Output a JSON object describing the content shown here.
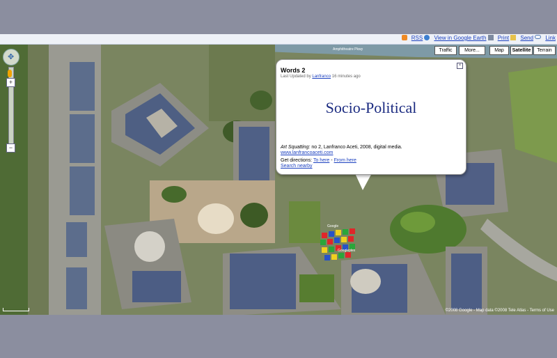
{
  "toolbar": {
    "rss": "RSS",
    "earth": "View in Google Earth",
    "print": "Print",
    "send": "Send",
    "link": "Link"
  },
  "map_controls": {
    "traffic": "Traffic",
    "more": "More...",
    "map": "Map",
    "satellite": "Satellite",
    "terrain": "Terrain",
    "selected": "Satellite"
  },
  "info_window": {
    "title": "Words 2",
    "updated_prefix": "Last Updated by",
    "author": "Lanfranco",
    "updated_suffix": "16 minutes ago",
    "heading": "Socio-Political",
    "caption_work": "Art Squatting:",
    "caption_rest": " no 2, Lanfranco Aceti, 2008, digital media.",
    "website": "www.lanfrancoaceti.com",
    "directions_label": "Get directions:",
    "to_here": "To here",
    "separator": " - ",
    "from_here": "From here",
    "search_nearby": "Search nearby"
  },
  "map_labels": {
    "label_a": "Google",
    "label_b": "Googleplex",
    "road": "Amphitheatre Pkwy",
    "copyright": "©2008 Google - Map data ©2008 Tele Atlas - Terms of Use"
  },
  "colors": {
    "heading": "#1a2a80",
    "link": "#1a3fbf",
    "background": "#8b8e9f"
  }
}
